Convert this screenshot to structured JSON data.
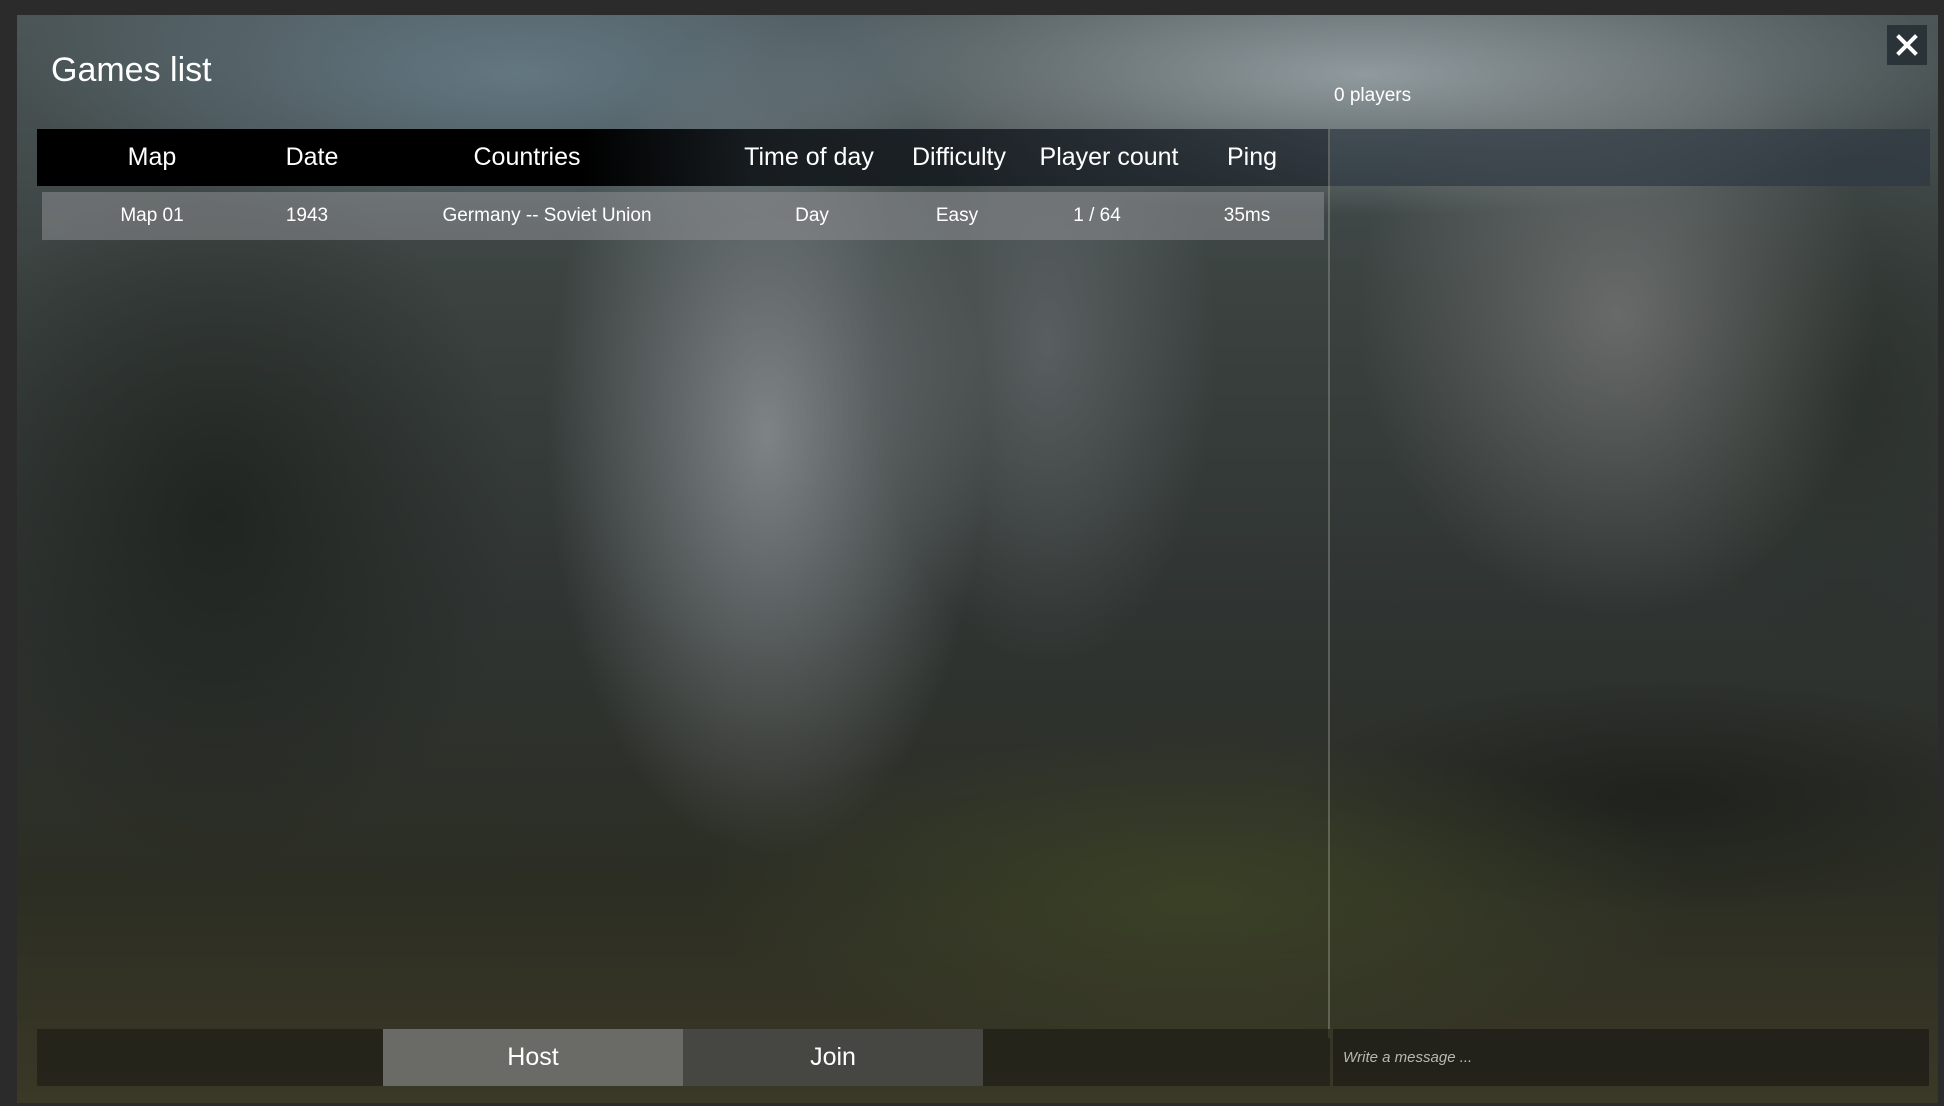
{
  "window": {
    "title": "Games list",
    "players_count": "0 players",
    "close_label": "close"
  },
  "table": {
    "columns": [
      "Map",
      "Date",
      "Countries",
      "Time of day",
      "Difficulty",
      "Player count",
      "Ping"
    ],
    "rows": [
      {
        "map": "Map 01",
        "date": "1943",
        "countries": "Germany -- Soviet Union",
        "time_of_day": "Day",
        "difficulty": "Easy",
        "player_count": "1 / 64",
        "ping": "35ms"
      }
    ]
  },
  "actions": {
    "host_label": "Host",
    "join_label": "Join"
  },
  "chat": {
    "placeholder": "Write a message ..."
  },
  "colors": {
    "header_bg": "#000000",
    "row_bg": "#8c8e91",
    "host_button": "#6a6a66",
    "join_button": "#464743",
    "close_button": "#2a3338"
  },
  "icons": {
    "close": "close-icon"
  }
}
